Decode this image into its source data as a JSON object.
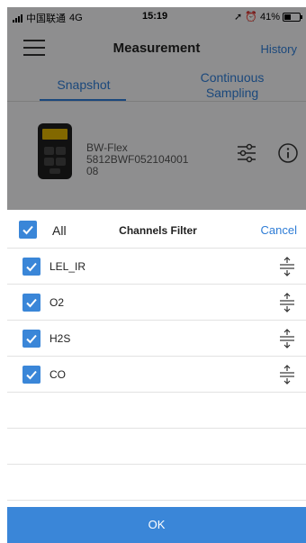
{
  "status_bar": {
    "carrier": "中国联通",
    "network": "4G",
    "time": "15:19",
    "battery": "41%"
  },
  "nav": {
    "title": "Measurement",
    "history_label": "History"
  },
  "tabs": [
    {
      "label": "Snapshot",
      "active": true
    },
    {
      "label": "Continuous Sampling",
      "line1": "Continuous",
      "line2": "Sampling",
      "active": false
    }
  ],
  "device": {
    "name": "BW-Flex",
    "serial_line1": "5812BWF052104001",
    "serial_line2": "08"
  },
  "filter": {
    "all_label": "All",
    "title": "Channels Filter",
    "cancel_label": "Cancel",
    "channels": [
      {
        "label": "LEL_IR",
        "checked": true
      },
      {
        "label": "O2",
        "checked": true
      },
      {
        "label": "H2S",
        "checked": true
      },
      {
        "label": "CO",
        "checked": true
      }
    ],
    "ok_label": "OK"
  },
  "colors": {
    "accent": "#3a86d8",
    "link": "#2f7dd6"
  }
}
